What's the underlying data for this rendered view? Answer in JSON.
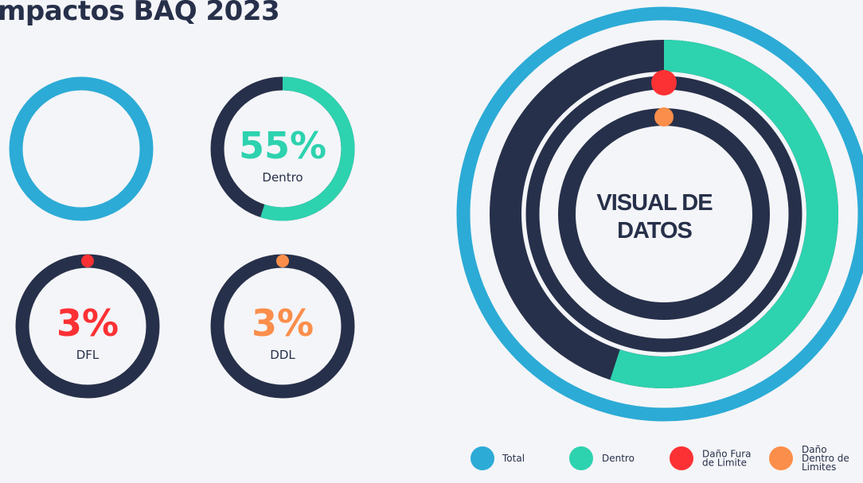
{
  "title": "mpactos BAQ 2023",
  "colors": {
    "dark": "#27304a",
    "total": "#2cabd6",
    "dentro": "#2dd2af",
    "dfl": "#fc3134",
    "ddl": "#fb8e4a",
    "background": "#f4f5f8"
  },
  "chart_data": [
    {
      "type": "donut",
      "series": [
        {
          "name": "Total",
          "value": 100,
          "color": "#2cabd6"
        }
      ]
    },
    {
      "type": "donut",
      "value_label": "55%",
      "label": "Dentro",
      "series": [
        {
          "name": "Dentro",
          "value": 55,
          "color": "#2dd2af"
        }
      ]
    },
    {
      "type": "donut",
      "value_label": "3%",
      "label": "DFL",
      "series": [
        {
          "name": "DFL",
          "value": 3,
          "color": "#fc3134"
        }
      ]
    },
    {
      "type": "donut",
      "value_label": "3%",
      "label": "DDL",
      "series": [
        {
          "name": "DDL",
          "value": 3,
          "color": "#fb8e4a"
        }
      ]
    },
    {
      "type": "radial-bar",
      "center_text": [
        "VISUAL DE",
        "DATOS"
      ],
      "series": [
        {
          "name": "Total",
          "value": 100,
          "color": "#2cabd6"
        },
        {
          "name": "Dentro",
          "value": 55,
          "color": "#2dd2af"
        },
        {
          "name": "Daño Fura de Limite",
          "value": 3,
          "color": "#fc3134"
        },
        {
          "name": "Daño Dentro de Limites",
          "value": 3,
          "color": "#fb8e4a"
        }
      ],
      "legend": [
        {
          "lines": [
            "Total"
          ],
          "color": "#2cabd6"
        },
        {
          "lines": [
            "Dentro"
          ],
          "color": "#2dd2af"
        },
        {
          "lines": [
            "Daño Fura",
            "de Limite"
          ],
          "color": "#fc3134"
        },
        {
          "lines": [
            "Daño",
            "Dentro de",
            "Limites"
          ],
          "color": "#fb8e4a"
        }
      ]
    }
  ]
}
